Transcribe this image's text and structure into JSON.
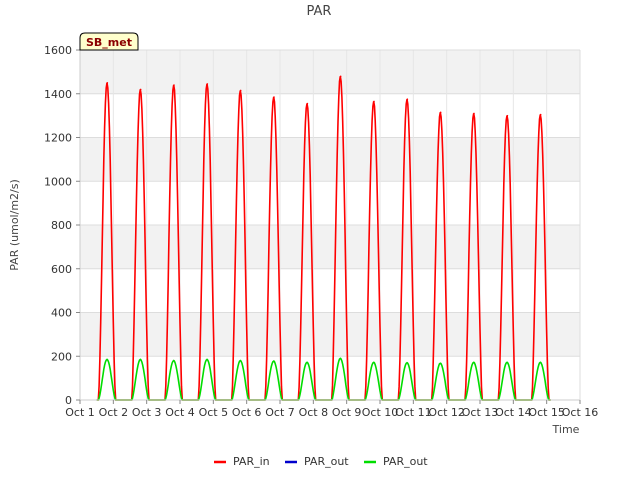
{
  "chart_data": {
    "type": "line",
    "title": "PAR",
    "xlabel": "Time",
    "ylabel": "PAR (umol/m2/s)",
    "site_label": "SB_met",
    "xlim": [
      1,
      16
    ],
    "ylim": [
      0,
      1600
    ],
    "x_ticks": [
      {
        "value": 1,
        "label": "Oct 1"
      },
      {
        "value": 2,
        "label": "Oct 2"
      },
      {
        "value": 3,
        "label": "Oct 3"
      },
      {
        "value": 4,
        "label": "Oct 4"
      },
      {
        "value": 5,
        "label": "Oct 5"
      },
      {
        "value": 6,
        "label": "Oct 6"
      },
      {
        "value": 7,
        "label": "Oct 7"
      },
      {
        "value": 8,
        "label": "Oct 8"
      },
      {
        "value": 9,
        "label": "Oct 9"
      },
      {
        "value": 10,
        "label": "Oct 10"
      },
      {
        "value": 11,
        "label": "Oct 11"
      },
      {
        "value": 12,
        "label": "Oct 12"
      },
      {
        "value": 13,
        "label": "Oct 13"
      },
      {
        "value": 14,
        "label": "Oct 14"
      },
      {
        "value": 15,
        "label": "Oct 15"
      },
      {
        "value": 16,
        "label": "Oct 16"
      }
    ],
    "y_ticks": [
      0,
      200,
      400,
      600,
      800,
      1000,
      1200,
      1400,
      1600
    ],
    "grid": true,
    "legend_position": "bottom-center",
    "series": [
      {
        "name": "PAR_in",
        "color": "#ff0000",
        "daily_peaks": [
          {
            "day": "Oct 1",
            "peak": 1450,
            "x_start": 1.55,
            "x_peak": 1.82,
            "x_end": 2.07
          },
          {
            "day": "Oct 2",
            "peak": 1420,
            "x_start": 2.55,
            "x_peak": 2.82,
            "x_end": 3.07
          },
          {
            "day": "Oct 3",
            "peak": 1440,
            "x_start": 3.55,
            "x_peak": 3.82,
            "x_end": 4.07
          },
          {
            "day": "Oct 4",
            "peak": 1445,
            "x_start": 4.55,
            "x_peak": 4.82,
            "x_end": 5.07
          },
          {
            "day": "Oct 5",
            "peak": 1415,
            "x_start": 5.55,
            "x_peak": 5.82,
            "x_end": 6.07
          },
          {
            "day": "Oct 6",
            "peak": 1385,
            "x_start": 6.55,
            "x_peak": 6.82,
            "x_end": 7.07
          },
          {
            "day": "Oct 7",
            "peak": 1355,
            "x_start": 7.55,
            "x_peak": 7.82,
            "x_end": 8.07
          },
          {
            "day": "Oct 8",
            "peak": 1480,
            "x_start": 8.55,
            "x_peak": 8.82,
            "x_end": 9.07
          },
          {
            "day": "Oct 9",
            "peak": 1365,
            "x_start": 9.55,
            "x_peak": 9.82,
            "x_end": 10.07
          },
          {
            "day": "Oct 10",
            "peak": 1375,
            "x_start": 10.55,
            "x_peak": 10.82,
            "x_end": 11.07
          },
          {
            "day": "Oct 11",
            "peak": 1315,
            "x_start": 11.55,
            "x_peak": 11.82,
            "x_end": 12.07
          },
          {
            "day": "Oct 12",
            "peak": 1310,
            "x_start": 12.55,
            "x_peak": 12.82,
            "x_end": 13.07
          },
          {
            "day": "Oct 13",
            "peak": 1300,
            "x_start": 13.55,
            "x_peak": 13.82,
            "x_end": 14.07
          },
          {
            "day": "Oct 14",
            "peak": 1305,
            "x_start": 14.55,
            "x_peak": 14.82,
            "x_end": 15.07
          }
        ]
      },
      {
        "name": "PAR_out",
        "color": "#0000cc",
        "daily_peaks": []
      },
      {
        "name": "PAR_out",
        "color": "#00dd00",
        "daily_peaks": [
          {
            "day": "Oct 1",
            "peak": 185,
            "x_start": 1.55,
            "x_peak": 1.82,
            "x_end": 2.07
          },
          {
            "day": "Oct 2",
            "peak": 185,
            "x_start": 2.55,
            "x_peak": 2.82,
            "x_end": 3.07
          },
          {
            "day": "Oct 3",
            "peak": 180,
            "x_start": 3.55,
            "x_peak": 3.82,
            "x_end": 4.07
          },
          {
            "day": "Oct 4",
            "peak": 185,
            "x_start": 4.55,
            "x_peak": 4.82,
            "x_end": 5.07
          },
          {
            "day": "Oct 5",
            "peak": 180,
            "x_start": 5.55,
            "x_peak": 5.82,
            "x_end": 6.07
          },
          {
            "day": "Oct 6",
            "peak": 178,
            "x_start": 6.55,
            "x_peak": 6.82,
            "x_end": 7.07
          },
          {
            "day": "Oct 7",
            "peak": 172,
            "x_start": 7.55,
            "x_peak": 7.82,
            "x_end": 8.07
          },
          {
            "day": "Oct 8",
            "peak": 190,
            "x_start": 8.55,
            "x_peak": 8.82,
            "x_end": 9.07
          },
          {
            "day": "Oct 9",
            "peak": 172,
            "x_start": 9.55,
            "x_peak": 9.82,
            "x_end": 10.07
          },
          {
            "day": "Oct 10",
            "peak": 170,
            "x_start": 10.55,
            "x_peak": 10.82,
            "x_end": 11.07
          },
          {
            "day": "Oct 11",
            "peak": 168,
            "x_start": 11.55,
            "x_peak": 11.82,
            "x_end": 12.07
          },
          {
            "day": "Oct 12",
            "peak": 172,
            "x_start": 12.55,
            "x_peak": 12.82,
            "x_end": 13.07
          },
          {
            "day": "Oct 13",
            "peak": 172,
            "x_start": 13.55,
            "x_peak": 13.82,
            "x_end": 14.07
          },
          {
            "day": "Oct 14",
            "peak": 172,
            "x_start": 14.55,
            "x_peak": 14.82,
            "x_end": 15.07
          }
        ]
      }
    ],
    "legend": [
      {
        "label": "PAR_in",
        "color": "#ff0000"
      },
      {
        "label": "PAR_out",
        "color": "#0000cc"
      },
      {
        "label": "PAR_out",
        "color": "#00dd00"
      }
    ]
  }
}
